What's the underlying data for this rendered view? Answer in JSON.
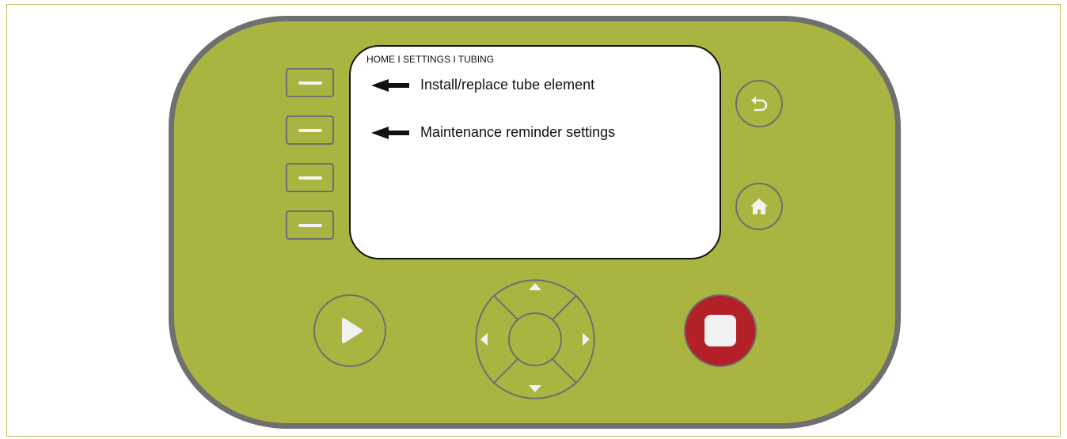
{
  "screen": {
    "breadcrumb": "HOME I SETTINGS I TUBING",
    "menu_items": [
      {
        "label": "Install/replace tube element"
      },
      {
        "label": "Maintenance reminder settings"
      }
    ]
  },
  "icons": {
    "softkeys": [
      "softkey-1",
      "softkey-2",
      "softkey-3",
      "softkey-4"
    ],
    "back": "back-arrow-icon",
    "home": "home-icon",
    "play": "play-icon",
    "stop": "stop-icon",
    "dpad": [
      "up-icon",
      "down-icon",
      "left-icon",
      "right-icon"
    ]
  },
  "colors": {
    "panel": "#a9b540",
    "border": "#6f6f6f",
    "stop_button": "#b32028",
    "icon_fill": "#f2f2f2"
  }
}
